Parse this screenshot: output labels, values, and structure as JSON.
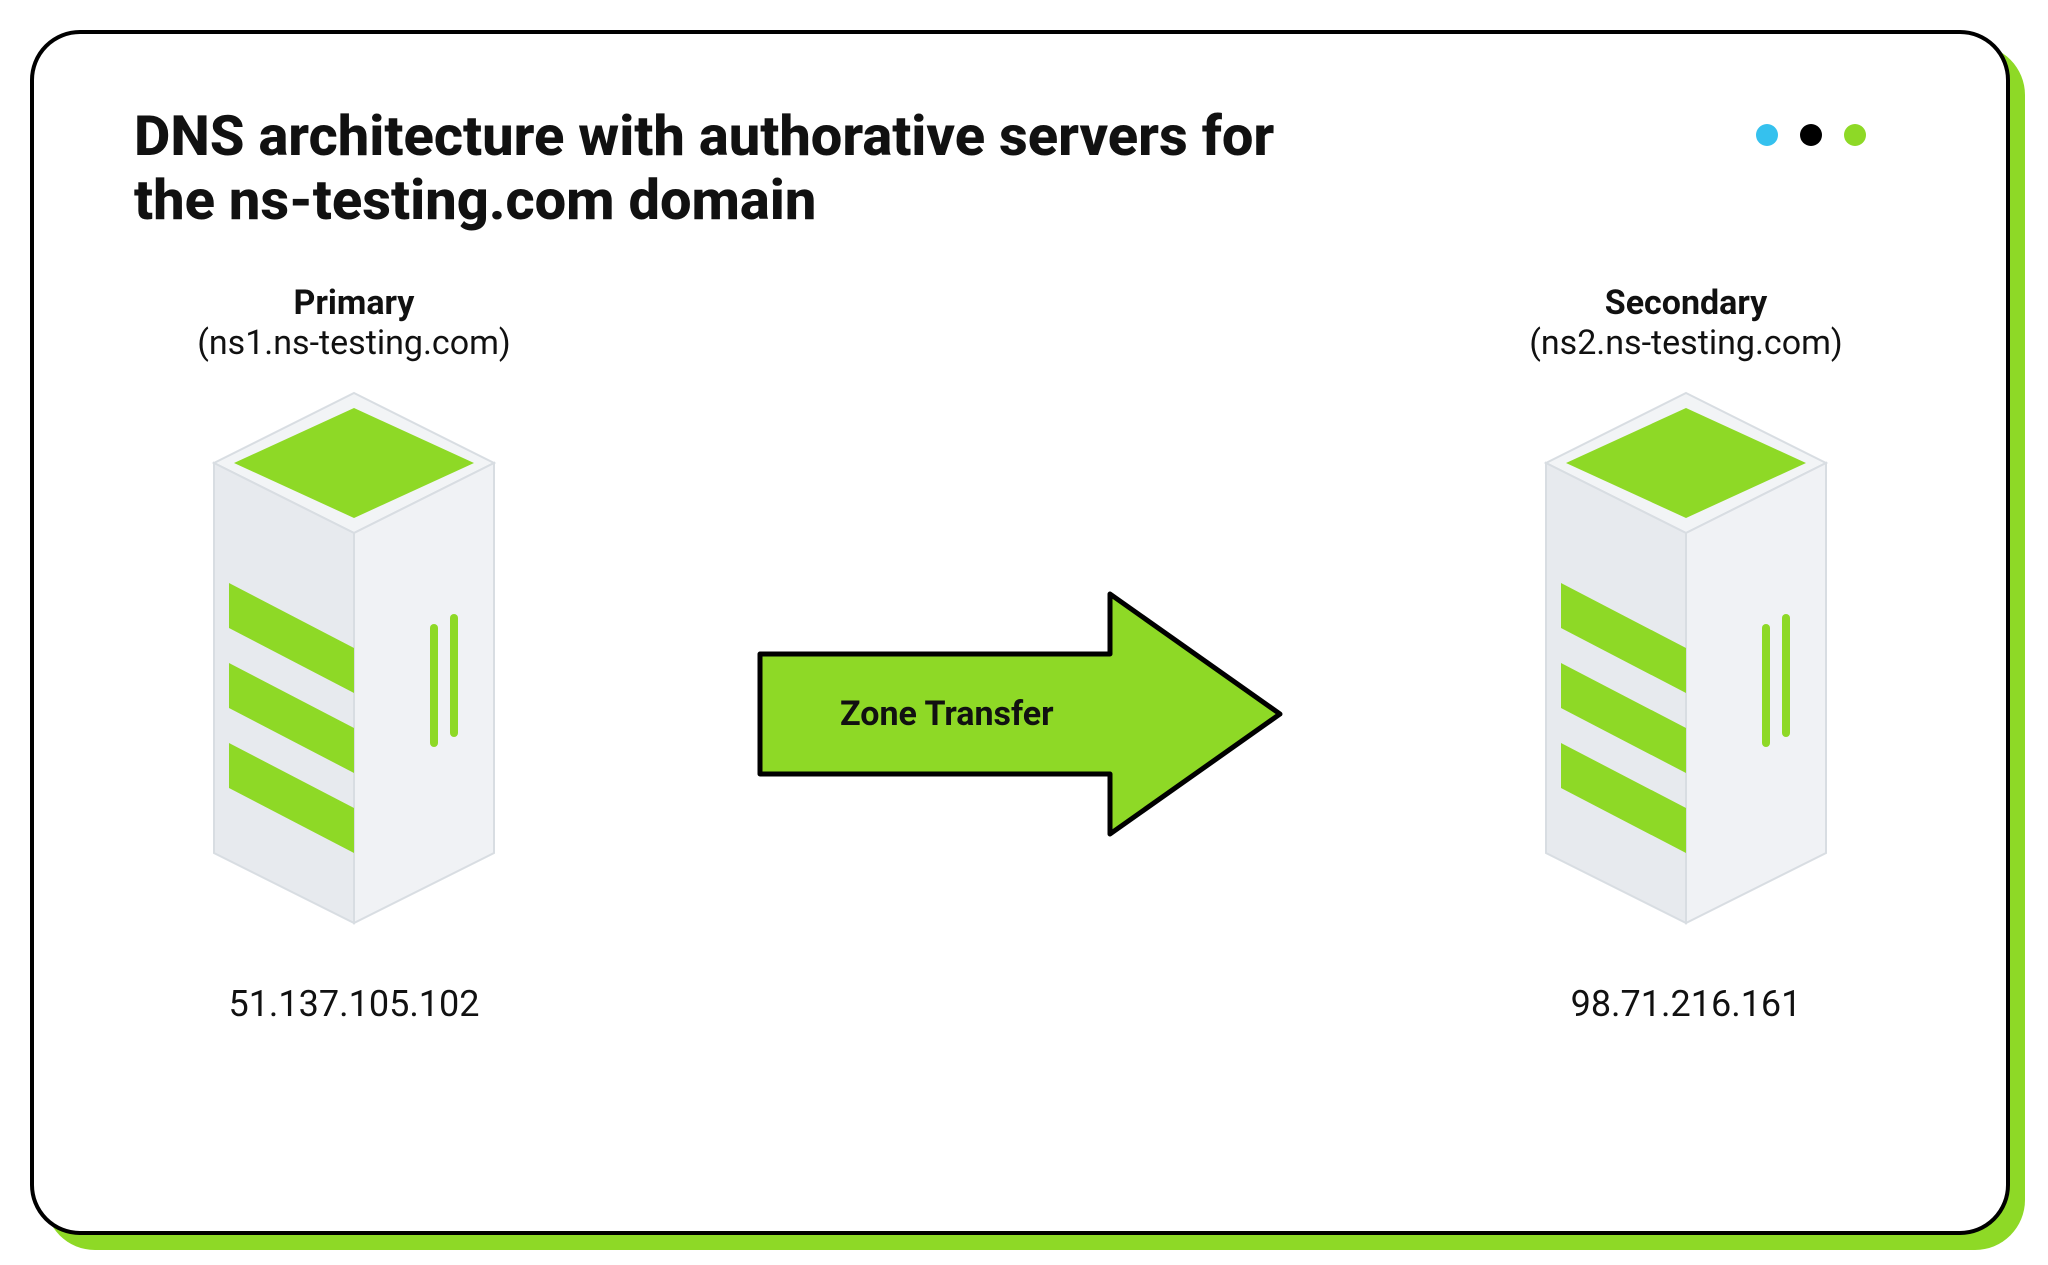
{
  "title": "DNS architecture with authorative servers for the ns-testing.com domain",
  "left": {
    "role": "Primary",
    "host": "(ns1.ns-testing.com)",
    "ip": "51.137.105.102"
  },
  "right": {
    "role": "Secondary",
    "host": "(ns2.ns-testing.com)",
    "ip": "98.71.216.161"
  },
  "arrow": {
    "label": "Zone Transfer"
  },
  "colors": {
    "accent": "#8ed926",
    "blue": "#35c1ee",
    "black": "#000000"
  }
}
